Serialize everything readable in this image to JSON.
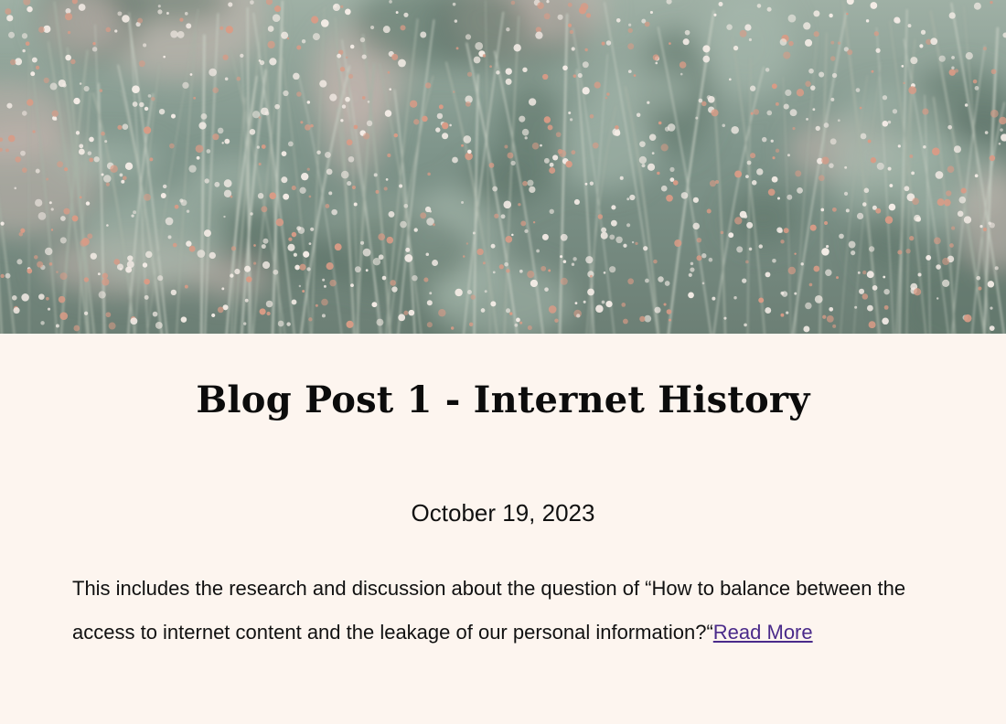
{
  "hero": {
    "image_icon": "dried-grass-flowers-photo",
    "colors": {
      "background": "#7f958b",
      "flower_white": "#f4ece6",
      "flower_pink": "#d99b86"
    }
  },
  "post": {
    "title": "Blog Post 1 - Internet History",
    "date": "October 19, 2023",
    "excerpt": "This includes the research and discussion about the question of “How to balance between the access to internet content and the leakage of our personal information?“",
    "read_more_label": "Read More"
  },
  "colors": {
    "page_background": "#fdf5ef",
    "link": "#4a2a8a",
    "text": "#111111"
  }
}
